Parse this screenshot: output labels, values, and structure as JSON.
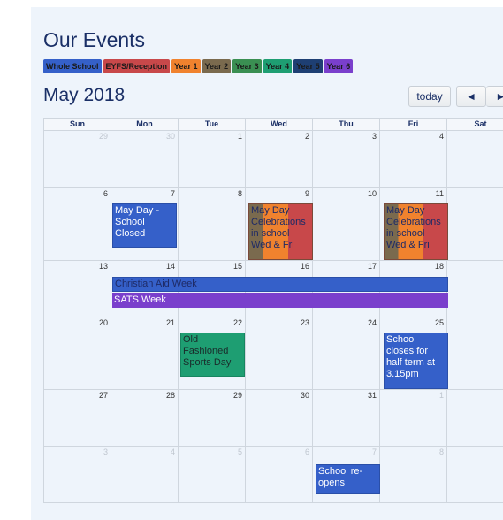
{
  "page": {
    "title": "Our Events",
    "month_title": "May 2018"
  },
  "legend": [
    {
      "label": "Whole School",
      "color": "#3560c9"
    },
    {
      "label": "EYFS/Reception",
      "color": "#c8484a"
    },
    {
      "label": "Year 1",
      "color": "#f0822e"
    },
    {
      "label": "Year 2",
      "color": "#7a6a4e"
    },
    {
      "label": "Year 3",
      "color": "#3a8f52"
    },
    {
      "label": "Year 4",
      "color": "#1e9e72"
    },
    {
      "label": "Year 5",
      "color": "#1e3f73"
    },
    {
      "label": "Year 6",
      "color": "#7a3fcc"
    }
  ],
  "toolbar": {
    "today_label": "today",
    "prev_icon": "◄",
    "next_icon": "►"
  },
  "calendar": {
    "day_headers": [
      "Sun",
      "Mon",
      "Tue",
      "Wed",
      "Thu",
      "Fri",
      "Sat"
    ],
    "weeks": [
      {
        "days": [
          "29",
          "30",
          "1",
          "2",
          "3",
          "4",
          ""
        ]
      },
      {
        "days": [
          "6",
          "7",
          "8",
          "9",
          "10",
          "11",
          ""
        ]
      },
      {
        "days": [
          "13",
          "14",
          "15",
          "16",
          "17",
          "18",
          ""
        ]
      },
      {
        "days": [
          "20",
          "21",
          "22",
          "23",
          "24",
          "25",
          ""
        ]
      },
      {
        "days": [
          "27",
          "28",
          "29",
          "30",
          "31",
          "1",
          ""
        ]
      },
      {
        "days": [
          "3",
          "4",
          "5",
          "6",
          "7",
          "8",
          ""
        ]
      }
    ],
    "events": {
      "may_day": "May Day - School Closed",
      "may_day_celebrations_wed": "May Day Celebrations in school Wed & Fri",
      "may_day_celebrations_fri": "May Day Celebrations in school Wed & Fri",
      "christian_aid_week": "Christian Aid Week",
      "sats_week": "SATS Week",
      "sports_day": "Old Fashioned Sports Day",
      "half_term": "School closes for half term at 3.15pm",
      "school_reopens": "School re-opens"
    }
  }
}
